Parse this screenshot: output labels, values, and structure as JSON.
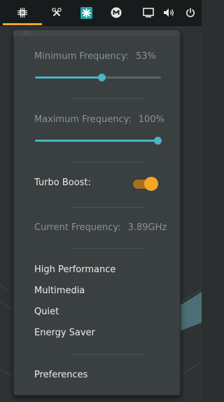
{
  "panel": {
    "indicators": [
      {
        "icon": "cpufreq-icon",
        "active": true
      },
      {
        "icon": "tools-icon"
      },
      {
        "icon": "app-indicator-icon"
      },
      {
        "icon": "mega-icon"
      },
      {
        "icon": "display-icon"
      },
      {
        "icon": "volume-icon"
      },
      {
        "icon": "power-icon"
      }
    ],
    "active_accent": "#f5a623"
  },
  "popup": {
    "min_frequency": {
      "label": "Minimum Frequency:",
      "value": "53%",
      "level": 0.53
    },
    "max_frequency": {
      "label": "Maximum Frequency:",
      "value": "100%",
      "level": 1.0
    },
    "turbo_boost": {
      "label": "Turbo Boost:",
      "enabled": true
    },
    "current_frequency": {
      "label": "Current Frequency:",
      "value": "3.89GHz"
    },
    "profiles": [
      "High Performance",
      "Multimedia",
      "Quiet",
      "Energy Saver"
    ],
    "preferences_label": "Preferences",
    "colors": {
      "slider": "#4ab5c4",
      "toggle": "#f5a623",
      "text": "#eceeee",
      "muted": "#8c9292"
    }
  }
}
